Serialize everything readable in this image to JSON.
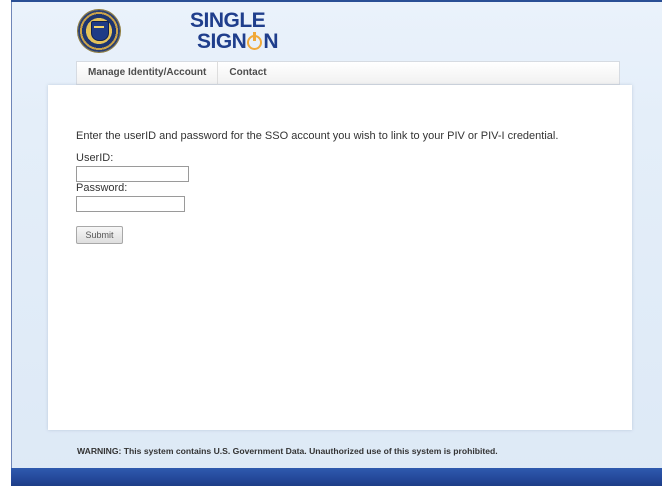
{
  "header": {
    "logo_line1": "SINGLE",
    "logo_line2_prefix": "SIGN",
    "logo_line2_suffix": "N",
    "seal_icon": "treasury-seal-icon"
  },
  "nav": {
    "items": [
      {
        "label": "Manage Identity/Account"
      },
      {
        "label": "Contact"
      }
    ]
  },
  "main": {
    "instructions": "Enter the userID and password for the SSO account you wish to link to your PIV or PIV-I credential.",
    "userid_label": "UserID:",
    "userid_value": "",
    "password_label": "Password:",
    "password_value": "",
    "submit_label": "Submit"
  },
  "footer": {
    "warning": "WARNING: This system contains U.S. Government Data. Unauthorized use of this system is prohibited."
  },
  "colors": {
    "brand_blue": "#1f3e8c",
    "accent_orange": "#f0a93a",
    "footer_bar": "#24489a",
    "page_background": "#e4eef9"
  }
}
